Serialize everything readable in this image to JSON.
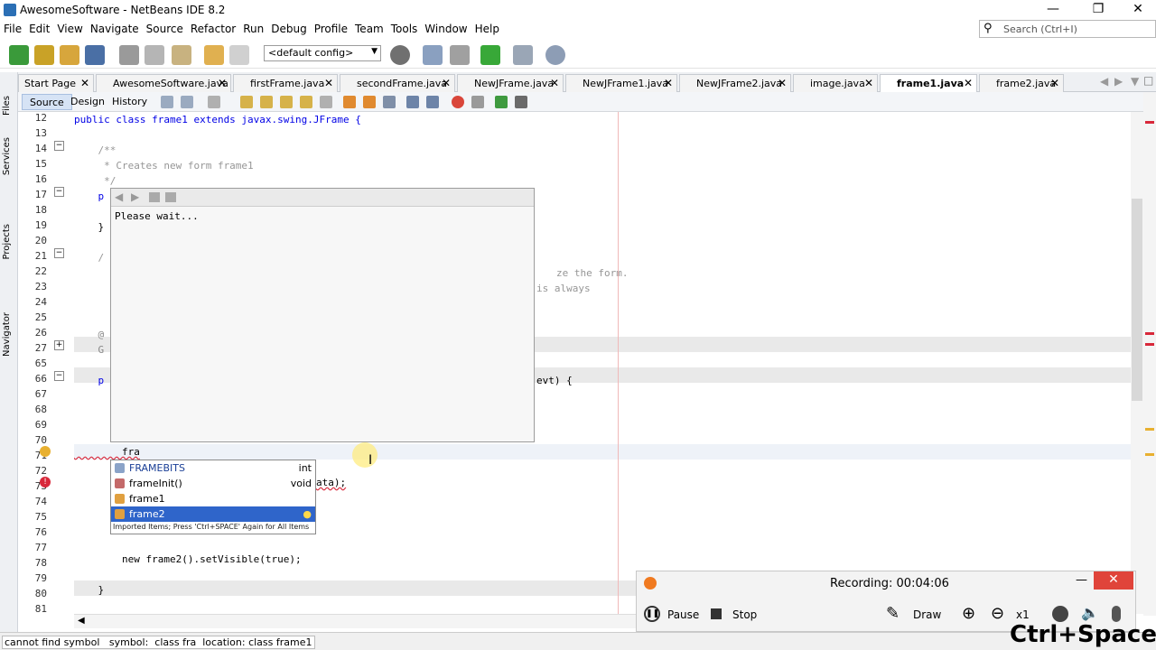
{
  "window": {
    "title": "AwesomeSoftware - NetBeans IDE 8.2"
  },
  "menu": [
    "File",
    "Edit",
    "View",
    "Navigate",
    "Source",
    "Refactor",
    "Run",
    "Debug",
    "Profile",
    "Team",
    "Tools",
    "Window",
    "Help"
  ],
  "search": {
    "placeholder": "Search (Ctrl+I)"
  },
  "toolbar": {
    "config": "<default config>"
  },
  "side_tabs": [
    "Files",
    "Services",
    "Projects",
    "Navigator"
  ],
  "tabs": [
    {
      "label": "Start Page"
    },
    {
      "label": "AwesomeSoftware.java"
    },
    {
      "label": "firstFrame.java"
    },
    {
      "label": "secondFrame.java"
    },
    {
      "label": "NewJFrame.java"
    },
    {
      "label": "NewJFrame1.java"
    },
    {
      "label": "NewJFrame2.java"
    },
    {
      "label": "image.java"
    },
    {
      "label": "frame1.java"
    },
    {
      "label": "frame2.java"
    }
  ],
  "editor_tabs": {
    "source": "Source",
    "design": "Design",
    "history": "History"
  },
  "lines": [
    "12",
    "13",
    "14",
    "15",
    "16",
    "17",
    "18",
    "19",
    "20",
    "21",
    "22",
    "23",
    "24",
    "25",
    "26",
    "27",
    "65",
    "66",
    "67",
    "68",
    "69",
    "70",
    "71",
    "72",
    "73",
    "74",
    "75",
    "76",
    "77",
    "78",
    "79",
    "80",
    "81"
  ],
  "code": {
    "l12": "public class frame1 extends javax.swing.JFrame {",
    "l14": "    /**",
    "l15": "     * Creates new form frame1",
    "l16": "     */",
    "l17": "    p",
    "l19": "    }",
    "l21": "    /",
    "l22tail": "ze the form.",
    "l23tail": "is always",
    "l26": "    @",
    "l27": "    G",
    "l66": "    p",
    "l66tail": "evt) {",
    "l71": "        fra",
    "l73tail": "ata);",
    "l78": "        new frame2().setVisible(true);",
    "l80": "    }"
  },
  "doc_popup": {
    "text": "Please wait..."
  },
  "completion": {
    "items": [
      {
        "name": "FRAMEBITS",
        "type": "int"
      },
      {
        "name": "frameInit()",
        "type": "void"
      },
      {
        "name": "frame1",
        "type": ""
      },
      {
        "name": "frame2",
        "type": ""
      }
    ],
    "footer": "Imported Items; Press 'Ctrl+SPACE' Again for All Items"
  },
  "status": {
    "text": "cannot find symbol   symbol:  class fra  location: class frame1"
  },
  "recorder": {
    "title": "Recording:  00:04:06",
    "pause": "Pause",
    "stop": "Stop",
    "draw": "Draw",
    "zoom": "x1"
  },
  "overlay": {
    "keys": "Ctrl+Space"
  },
  "colors": {
    "accent": "#2f65ca",
    "close": "#e0443a",
    "keyword": "#0000e6",
    "comment": "#969696"
  }
}
